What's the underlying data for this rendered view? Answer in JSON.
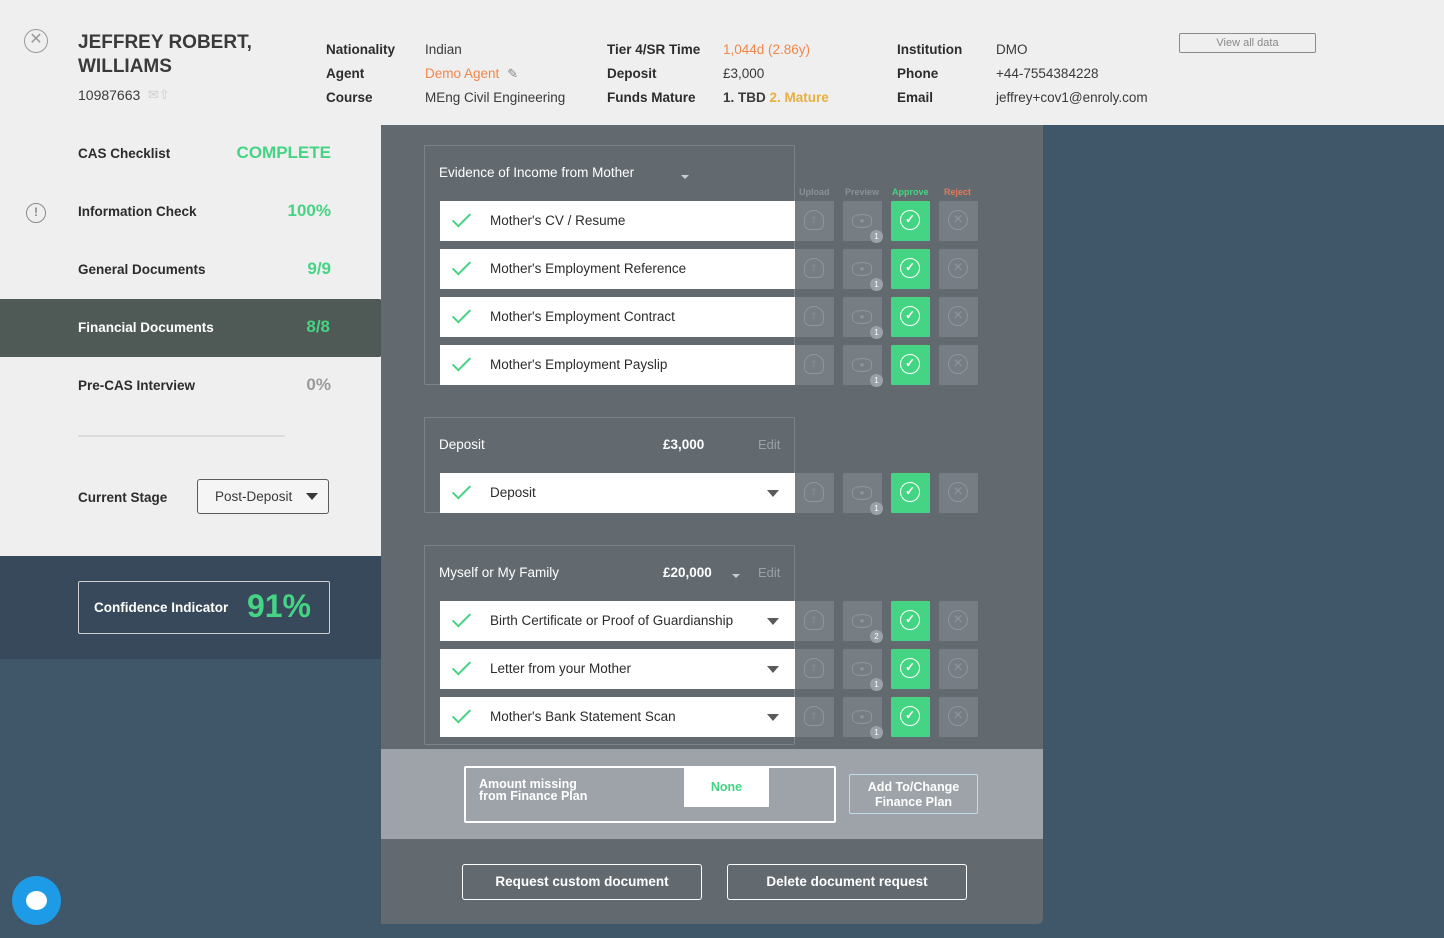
{
  "header": {
    "close_icon": "close-circle-icon",
    "name": "JEFFREY ROBERT, WILLIAMS",
    "student_id": "10987663",
    "col1": {
      "labels": [
        "Nationality",
        "Agent",
        "Course"
      ],
      "values": [
        "Indian",
        "Demo Agent",
        "MEng Civil Engineering"
      ]
    },
    "col2": {
      "labels": [
        "Tier 4/SR Time",
        "Deposit",
        "Funds Mature"
      ],
      "tier_time": "1,044d (2.86y)",
      "deposit": "£3,000",
      "funds_mature_1": "1. TBD",
      "funds_mature_2": "2. Mature"
    },
    "col3": {
      "labels": [
        "Institution",
        "Phone",
        "Email"
      ],
      "values": [
        "DMO",
        "+44-7554384228",
        "jeffrey+cov1@enroly.com"
      ]
    },
    "view_all_label": "View all data"
  },
  "sidebar": {
    "items": [
      {
        "label": "CAS Checklist",
        "value": "COMPLETE"
      },
      {
        "label": "Information Check",
        "value": "100%"
      },
      {
        "label": "General Documents",
        "value": "9/9"
      },
      {
        "label": "Financial Documents",
        "value": "8/8"
      },
      {
        "label": "Pre-CAS Interview",
        "value": "0%"
      }
    ],
    "current_stage_label": "Current Stage",
    "current_stage_value": "Post-Deposit",
    "confidence_label": "Confidence Indicator",
    "confidence_value": "91%"
  },
  "columns": {
    "upload": "Upload",
    "preview": "Preview",
    "approve": "Approve",
    "reject": "Reject"
  },
  "sections": {
    "income": {
      "title": "Evidence of Income from Mother",
      "docs": [
        {
          "name": "Mother's CV / Resume",
          "preview_count": "1"
        },
        {
          "name": "Mother's Employment Reference",
          "preview_count": "1"
        },
        {
          "name": "Mother's Employment Contract",
          "preview_count": "1"
        },
        {
          "name": "Mother's Employment Payslip",
          "preview_count": "1"
        }
      ]
    },
    "deposit": {
      "title": "Deposit",
      "amount": "£3,000",
      "edit": "Edit",
      "docs": [
        {
          "name": "Deposit",
          "preview_count": "1"
        }
      ]
    },
    "family": {
      "title": "Myself or My Family",
      "amount": "£20,000",
      "edit": "Edit",
      "docs": [
        {
          "name": "Birth Certificate or Proof of Guardianship",
          "preview_count": "2"
        },
        {
          "name": "Letter from your Mother",
          "preview_count": "1"
        },
        {
          "name": "Mother's Bank Statement Scan",
          "preview_count": "1"
        }
      ]
    }
  },
  "finance": {
    "amount_missing_line1": "Amount missing",
    "amount_missing_line2": "from Finance Plan",
    "amount_missing_value": "None",
    "add_change_line1": "Add To/Change",
    "add_change_line2": "Finance Plan"
  },
  "actions": {
    "request_custom": "Request custom document",
    "delete_request": "Delete document request"
  },
  "colors": {
    "green": "#45d483",
    "orange": "#f0874a",
    "sidebar_active": "#4f5a56",
    "main_panel": "#626a70",
    "background": "#40576a"
  }
}
